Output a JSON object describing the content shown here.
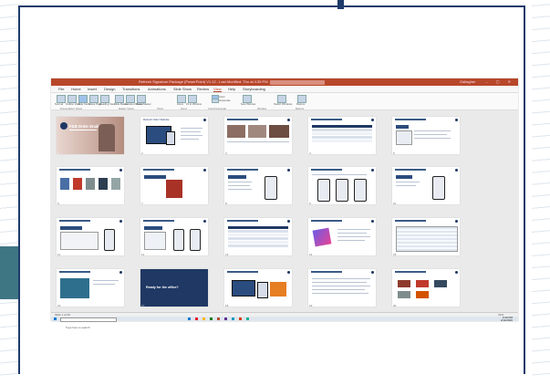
{
  "window": {
    "title": "Refresh Signature Package (PowerPoint) V1.12 - Last Modified: Thu at 4:35 PM",
    "search_placeholder": "Search",
    "user": "Gallagher"
  },
  "menu": [
    "File",
    "Home",
    "Insert",
    "Design",
    "Transitions",
    "Animations",
    "Slide Show",
    "Review",
    "View",
    "Help",
    "Storyboarding"
  ],
  "active_menu": "View",
  "ribbon": {
    "buttons": [
      "Normal",
      "Outline View",
      "Slide Sorter",
      "Notes Page",
      "Reading View",
      "Slide Master",
      "Handout Master",
      "Notes Master",
      "Zoom",
      "Fit to Window",
      "Color",
      "Grayscale",
      "New Window",
      "Switch Windows",
      "Macros"
    ],
    "groups": [
      "Presentation Views",
      "Master Views",
      "Show",
      "Zoom",
      "Color/Grayscale",
      "Window",
      "Macros"
    ]
  },
  "slides": [
    {
      "num": "1",
      "title": "F&B Order Enablement"
    },
    {
      "num": "2",
      "title": "Refresh Order Website"
    },
    {
      "num": "3"
    },
    {
      "num": "4"
    },
    {
      "num": "5"
    },
    {
      "num": "6"
    },
    {
      "num": "7"
    },
    {
      "num": "8"
    },
    {
      "num": "9"
    },
    {
      "num": "10"
    },
    {
      "num": "11"
    },
    {
      "num": "12"
    },
    {
      "num": "13"
    },
    {
      "num": "14"
    },
    {
      "num": "15"
    },
    {
      "num": "16"
    },
    {
      "num": "17",
      "title": "Ready for the office?"
    },
    {
      "num": "18"
    },
    {
      "num": "19"
    },
    {
      "num": "20"
    }
  ],
  "statusbar": {
    "left": "Slide 1 of 20",
    "zoom": "41%"
  },
  "taskbar": {
    "search_placeholder": "Type here to search",
    "time": "4:40 PM",
    "date": "2/11/2020",
    "app_colors": [
      "#0078d7",
      "#e81123",
      "#ffb900",
      "#107c10",
      "#b7472a",
      "#5c2d91",
      "#0099bc",
      "#d83b01",
      "#00b294"
    ]
  }
}
